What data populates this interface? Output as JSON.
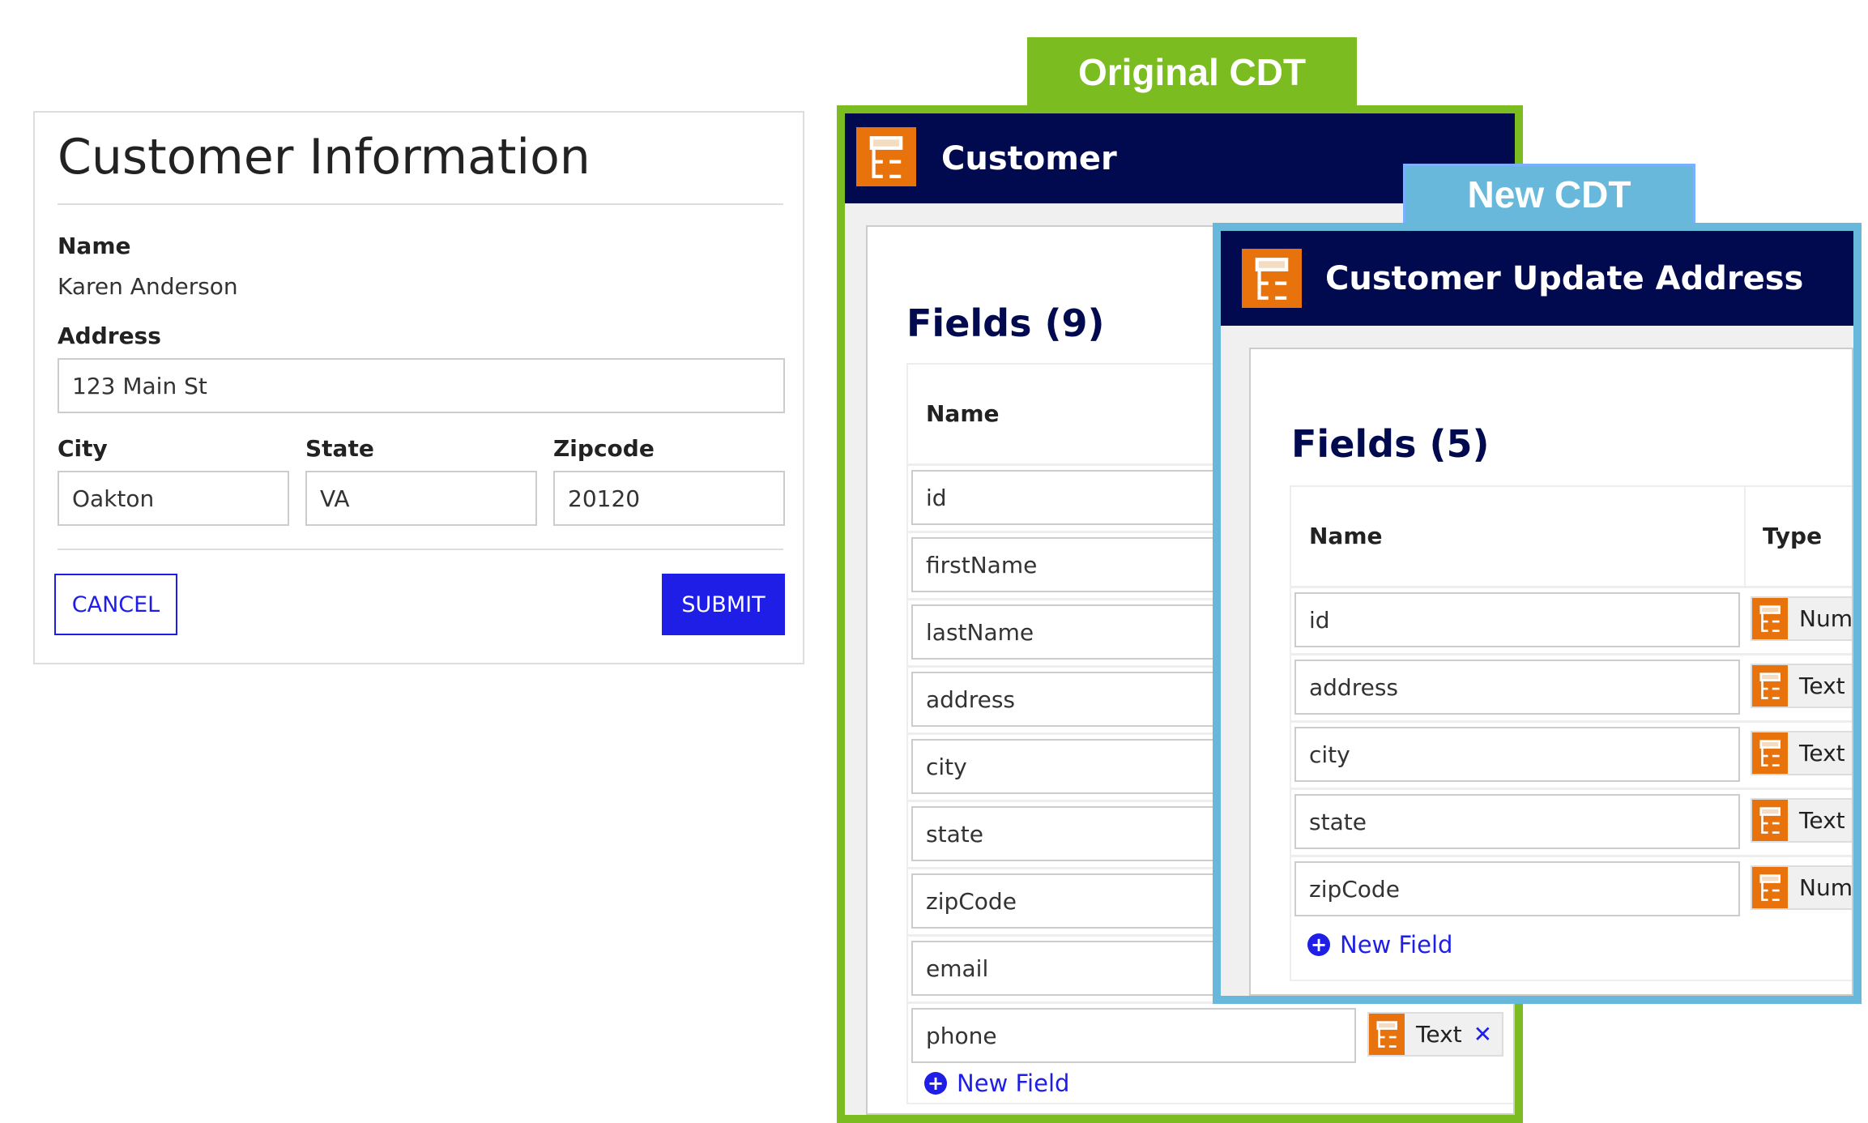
{
  "form": {
    "title": "Customer Information",
    "name_label": "Name",
    "name_value": "Karen Anderson",
    "address_label": "Address",
    "address_value": "123 Main St",
    "city_label": "City",
    "city_value": "Oakton",
    "state_label": "State",
    "state_value": "VA",
    "zip_label": "Zipcode",
    "zip_value": "20120",
    "cancel": "CANCEL",
    "submit": "SUBMIT",
    "accent": "#1e1ee6"
  },
  "original": {
    "tab": "Original CDT",
    "title": "Customer",
    "fields_title": "Fields (9)",
    "col_name": "Name",
    "fields": [
      {
        "name": "id"
      },
      {
        "name": "firstName"
      },
      {
        "name": "lastName"
      },
      {
        "name": "address"
      },
      {
        "name": "city"
      },
      {
        "name": "state"
      },
      {
        "name": "zipCode"
      },
      {
        "name": "email"
      },
      {
        "name": "phone",
        "type": "Text",
        "remove": "✕"
      }
    ],
    "new_field": "New Field",
    "color": "#7bbd21"
  },
  "updated": {
    "tab": "New CDT",
    "title": "Customer Update Address",
    "fields_title": "Fields (5)",
    "col_name": "Name",
    "col_type": "Type",
    "fields": [
      {
        "name": "id",
        "type": "Num"
      },
      {
        "name": "address",
        "type": "Text"
      },
      {
        "name": "city",
        "type": "Text"
      },
      {
        "name": "state",
        "type": "Text"
      },
      {
        "name": "zipCode",
        "type": "Num"
      }
    ],
    "new_field": "New Field",
    "color": "#68b8dc"
  },
  "icons": {
    "cdt": "data-type-icon",
    "add": "plus-circle-icon",
    "remove": "close-icon"
  },
  "colors": {
    "header": "#020a4f",
    "icon": "#e8720c"
  }
}
